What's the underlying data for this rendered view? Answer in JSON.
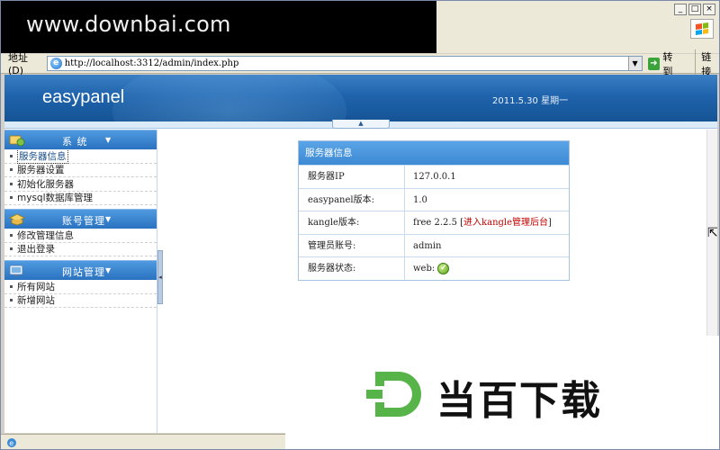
{
  "watermark_top": "www.downbai.com",
  "watermark_bottom": "当百下载",
  "address_bar": {
    "label": "地址",
    "label_key": "D",
    "url": "http://localhost:3312/admin/index.php",
    "go_label": "转到",
    "links_label": "链接"
  },
  "header": {
    "logo": "easypanel",
    "date": "2011.5.30  星期一"
  },
  "sidebar": {
    "groups": [
      {
        "title": "系  统",
        "items": [
          {
            "label": "服务器信息",
            "active": true
          },
          {
            "label": "服务器设置"
          },
          {
            "label": "初始化服务器"
          },
          {
            "label": "mysql数据库管理"
          }
        ]
      },
      {
        "title": "账号管理",
        "items": [
          {
            "label": "修改管理信息"
          },
          {
            "label": "退出登录"
          }
        ]
      },
      {
        "title": "网站管理",
        "items": [
          {
            "label": "所有网站"
          },
          {
            "label": "新增网站"
          }
        ]
      }
    ]
  },
  "server_info": {
    "title": "服务器信息",
    "rows": [
      {
        "key": "服务器IP",
        "value": "127.0.0.1"
      },
      {
        "key": "easypanel版本:",
        "value": "1.0"
      },
      {
        "key": "kangle版本:",
        "value": "free 2.2.5",
        "link_prefix": "[",
        "link": "进入kangle管理后台",
        "link_suffix": "]"
      },
      {
        "key": "管理员账号:",
        "value": "admin"
      },
      {
        "key": "服务器状态:",
        "value": "web:"
      }
    ]
  },
  "colors": {
    "header_blue": "#1f63ac",
    "sidebar_head_blue": "#2a72c0",
    "table_head_blue": "#3d8ad4",
    "link_red": "#c00000"
  }
}
